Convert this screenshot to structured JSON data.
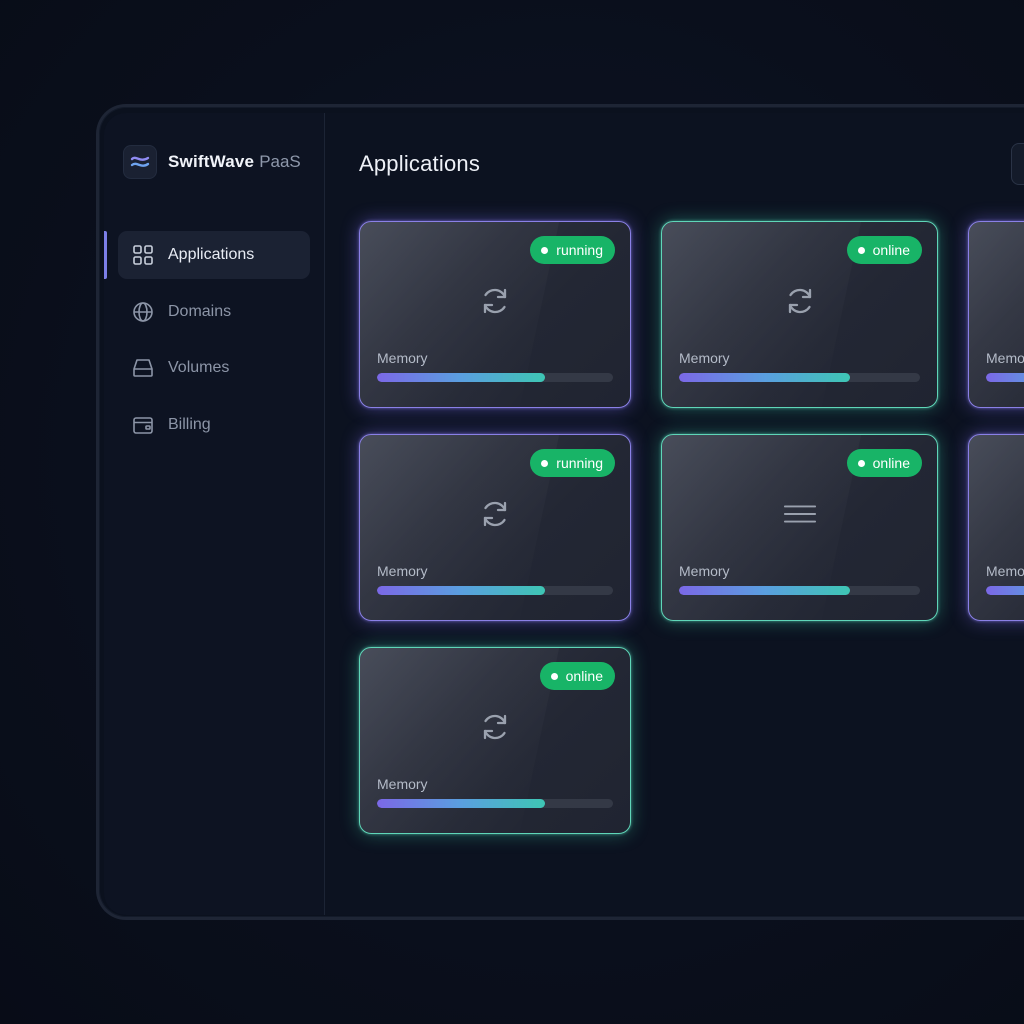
{
  "brand": {
    "name": "SwiftWave",
    "suffix": "PaaS",
    "logo_icon": "wave-logo-icon"
  },
  "sidebar": {
    "items": [
      {
        "label": "Applications",
        "icon": "grid-icon",
        "active": true
      },
      {
        "label": "Domains",
        "icon": "globe-icon",
        "active": false
      },
      {
        "label": "Volumes",
        "icon": "drive-icon",
        "active": false
      },
      {
        "label": "Billing",
        "icon": "wallet-icon",
        "active": false
      }
    ]
  },
  "main": {
    "title": "Applications"
  },
  "colors": {
    "accent": "#7c7fe8",
    "status_green": "#18b467",
    "card_purple": "#8a80e6",
    "card_teal": "#5fd6b8"
  },
  "apps": [
    {
      "status": "running",
      "icon": "refresh-icon",
      "memory_label": "Memory",
      "memory_fraction": 0.71,
      "glow": "purple"
    },
    {
      "status": "online",
      "icon": "refresh-icon",
      "memory_label": "Memory",
      "memory_fraction": 0.71,
      "glow": "teal"
    },
    {
      "status": "",
      "icon": "",
      "memory_label": "Memo",
      "memory_fraction": 0.71,
      "glow": "purple"
    },
    {
      "status": "running",
      "icon": "refresh-icon",
      "memory_label": "Memory",
      "memory_fraction": 0.71,
      "glow": "purple"
    },
    {
      "status": "online",
      "icon": "menu-icon",
      "memory_label": "Memory",
      "memory_fraction": 0.71,
      "glow": "teal"
    },
    {
      "status": "",
      "icon": "",
      "memory_label": "Memo",
      "memory_fraction": 0.71,
      "glow": "purple"
    },
    {
      "status": "online",
      "icon": "refresh-icon",
      "memory_label": "Memory",
      "memory_fraction": 0.71,
      "glow": "teal"
    }
  ]
}
